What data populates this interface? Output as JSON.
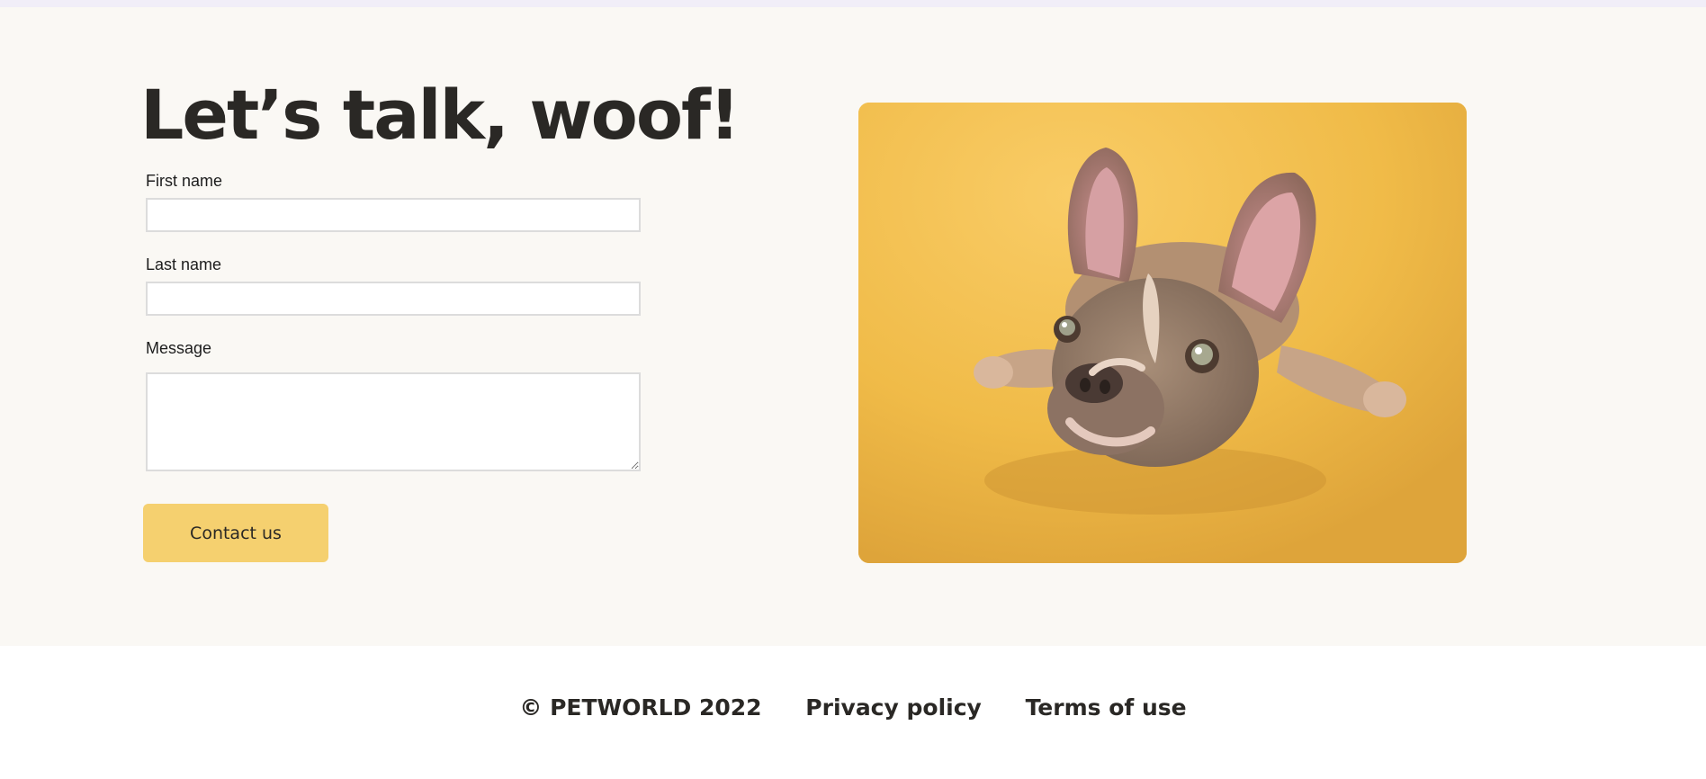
{
  "page": {
    "heading": "Let’s talk, woof!"
  },
  "form": {
    "first_name_label": "First name",
    "first_name_value": "",
    "last_name_label": "Last name",
    "last_name_value": "",
    "message_label": "Message",
    "message_value": "",
    "submit_label": "Contact us"
  },
  "image": {
    "subject": "french-bulldog-puppy-photo"
  },
  "footer": {
    "copyright": "© PETWORLD 2022",
    "privacy_label": "Privacy policy",
    "terms_label": "Terms of use"
  },
  "colors": {
    "page_background": "#faf8f4",
    "accent_button": "#f5d06f",
    "photo_background": "#f0bd4c",
    "text": "#2a2825"
  }
}
